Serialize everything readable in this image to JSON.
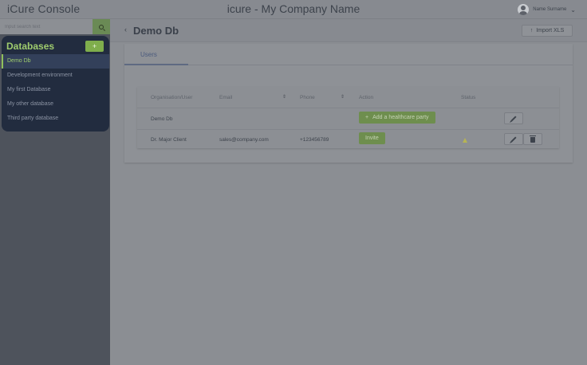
{
  "header": {
    "brand": "iCure Console",
    "title": "icure - My Company Name",
    "user_name": "Name Surname",
    "chevron": "⌄"
  },
  "sidebar": {
    "search_placeholder": "Input search text",
    "databases_title": "Databases",
    "add_label": "+",
    "items": [
      {
        "label": "Demo Db",
        "active": true
      },
      {
        "label": "Development environment"
      },
      {
        "label": "My first Database"
      },
      {
        "label": "My other database"
      },
      {
        "label": "Third party database"
      }
    ]
  },
  "main": {
    "back_glyph": "‹",
    "page_title": "Demo Db",
    "import_label": "Import XLS",
    "import_glyph": "↑",
    "tabs": [
      {
        "label": "Users"
      }
    ],
    "table": {
      "columns": [
        "Organisation/User",
        "Email",
        "Phone",
        "Action",
        "Status"
      ],
      "sort_glyph": "⇕",
      "rows": [
        {
          "name": "Demo Db",
          "email": "",
          "phone": "",
          "action": "Add a healthcare party",
          "action_glyph": "+",
          "status": ""
        },
        {
          "name": "Dr. Major Client",
          "email": "sales@company.com",
          "phone": "+123456789",
          "action": "Invite",
          "status": "warning"
        }
      ]
    }
  },
  "colors": {
    "accent_green": "#8fbf5c",
    "panel_navy": "#222c3f",
    "overlay_gray": "#8a8d93"
  },
  "icons": [
    "search-icon",
    "user-avatar-icon",
    "chevron-down-icon",
    "back-chevron-icon",
    "upload-icon",
    "sort-icon",
    "pencil-icon",
    "trash-icon",
    "warning-icon"
  ]
}
